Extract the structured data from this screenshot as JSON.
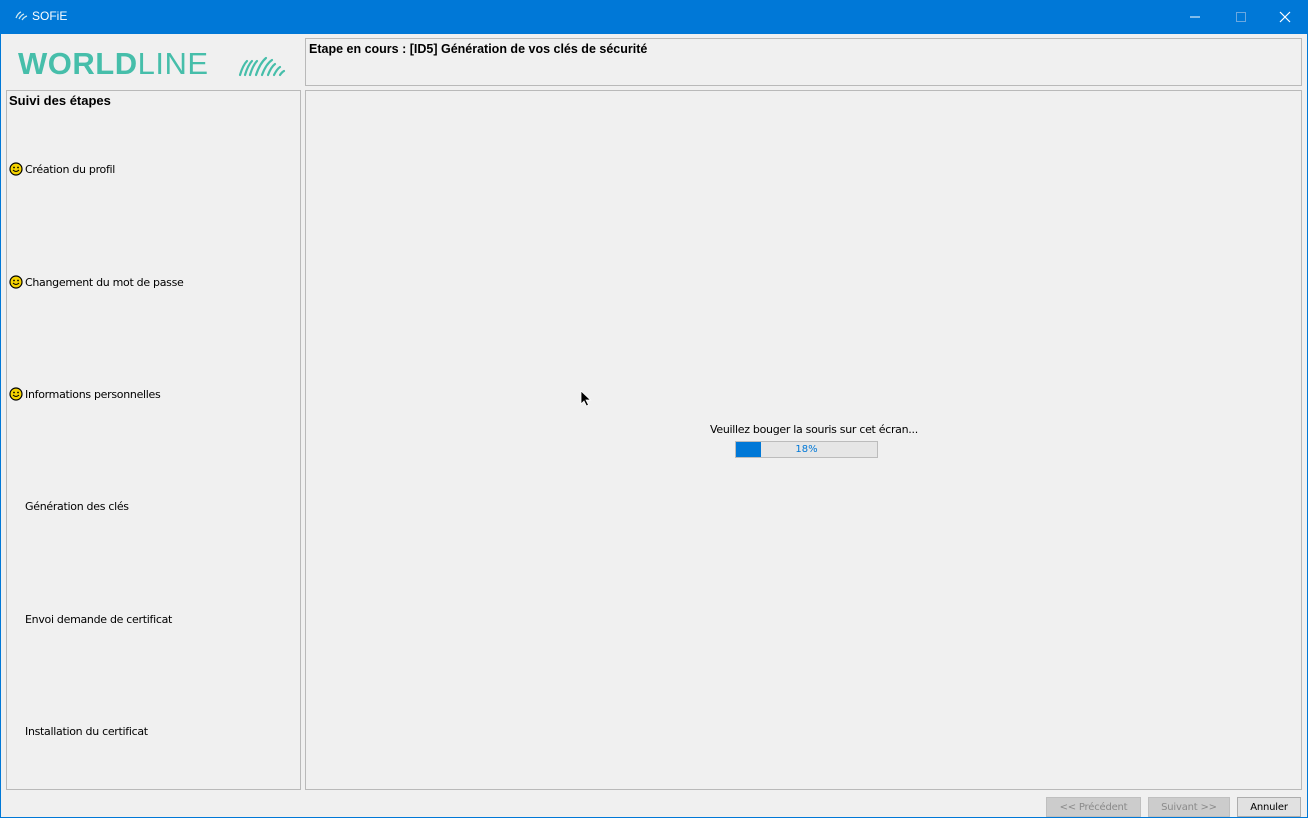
{
  "window": {
    "title": "SOFiE",
    "accent_color": "#0078d7",
    "controls": [
      "minimize-icon",
      "maximize-icon",
      "close-icon"
    ]
  },
  "logo": {
    "bold": "WORLD",
    "light": "LINE",
    "color": "#46beaa"
  },
  "header": {
    "current_step": "Etape en cours :  [ID5]  Génération de vos clés de sécurité"
  },
  "sidebar": {
    "title": "Suivi des étapes",
    "steps": [
      {
        "label": "Création du profil",
        "done": true,
        "icon": "smiley-icon"
      },
      {
        "label": "Changement du mot de passe",
        "done": true,
        "icon": "smiley-icon"
      },
      {
        "label": "Informations personnelles",
        "done": true,
        "icon": "smiley-icon"
      },
      {
        "label": "Génération des clés",
        "done": false
      },
      {
        "label": "Envoi demande de certificat",
        "done": false
      },
      {
        "label": "Installation du certificat",
        "done": false
      }
    ]
  },
  "main": {
    "message": "Veuillez bouger la souris sur cet écran...",
    "progress_value": 0.18,
    "progress_label": "18%"
  },
  "buttons": {
    "previous": "<< Précédent",
    "next": "Suivant >>",
    "cancel": "Annuler"
  }
}
